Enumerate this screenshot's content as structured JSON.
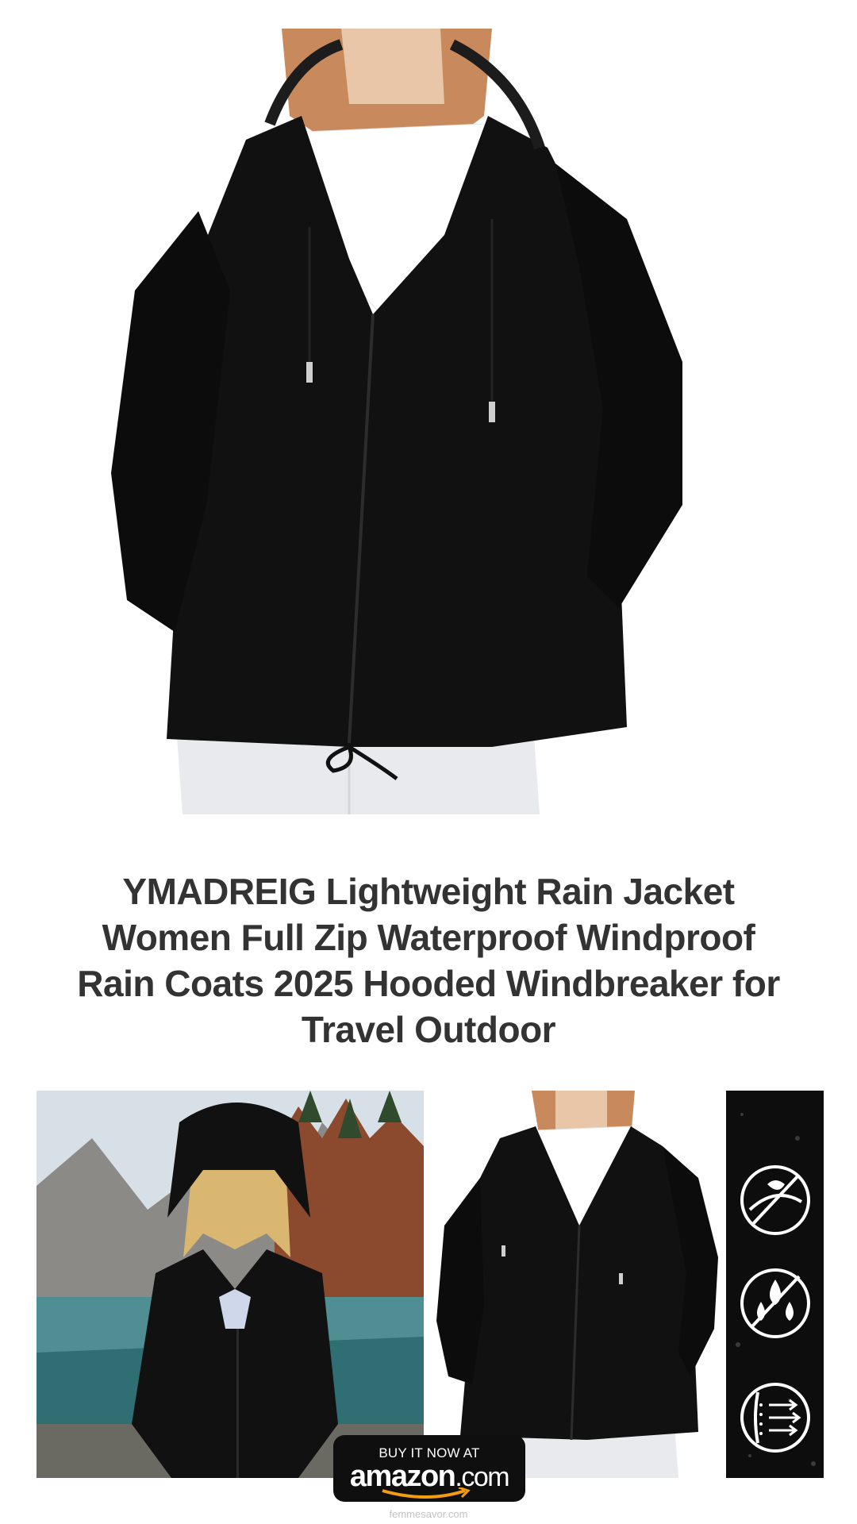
{
  "product": {
    "title_lines": [
      "YMADREIG Lightweight Rain Jacket",
      "Women Full Zip Waterproof Windproof",
      "Rain Coats 2025 Hooded Windbreaker for",
      "Travel Outdoor"
    ]
  },
  "images": {
    "hero": "model-wearing-black-rain-jacket",
    "thumbnails": [
      "model-outdoor-lake-scene",
      "model-front-view",
      "feature-icons-strip"
    ],
    "feature_icons": [
      "windproof-icon",
      "waterproof-icon",
      "breathable-icon"
    ]
  },
  "cta": {
    "top_label": "BUY IT NOW AT",
    "brand": "amazon",
    "brand_suffix": ".com"
  },
  "footer": {
    "site": "femmesavor.com"
  },
  "colors": {
    "jacket": "#111111",
    "title_text": "#333333",
    "cta_bg": "#0f0f0f",
    "amazon_smile": "#f39c12"
  }
}
